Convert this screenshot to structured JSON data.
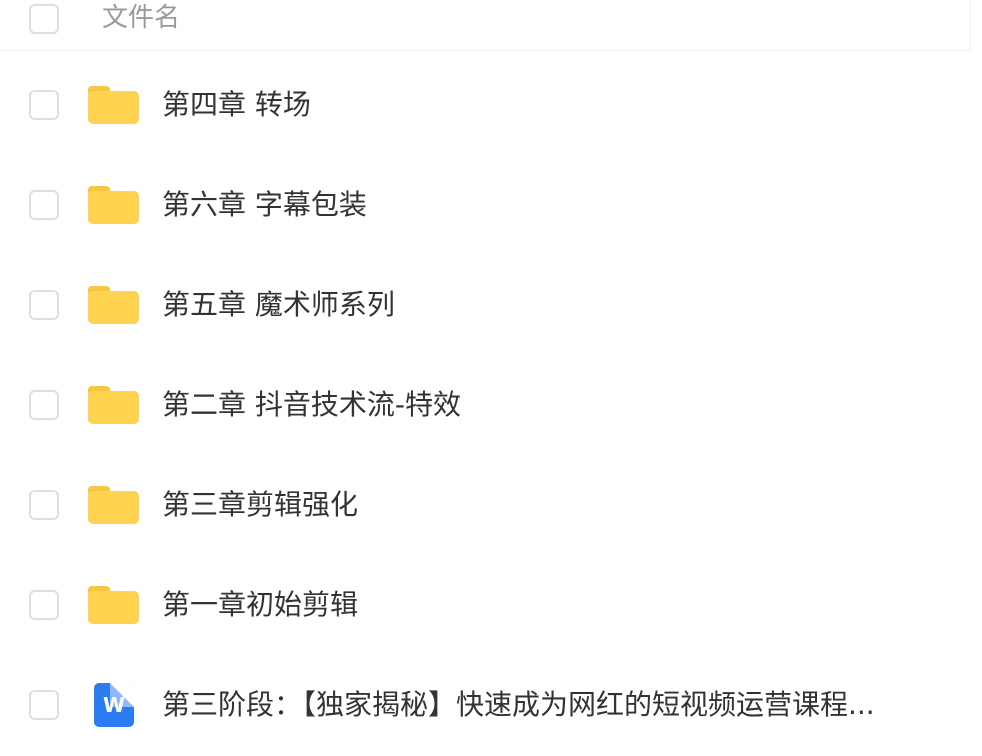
{
  "header": {
    "name_column_label": "文件名"
  },
  "files": [
    {
      "name": "第四章 转场",
      "type": "folder",
      "icon": "folder-icon"
    },
    {
      "name": "第六章 字幕包装",
      "type": "folder",
      "icon": "folder-icon"
    },
    {
      "name": "第五章 魔术师系列",
      "type": "folder",
      "icon": "folder-icon"
    },
    {
      "name": "第二章 抖音技术流-特效",
      "type": "folder",
      "icon": "folder-icon"
    },
    {
      "name": "第三章剪辑强化",
      "type": "folder",
      "icon": "folder-icon"
    },
    {
      "name": "第一章初始剪辑",
      "type": "folder",
      "icon": "folder-icon"
    },
    {
      "name": "第三阶段：【独家揭秘】快速成为网红的短视频运营课程...",
      "type": "document",
      "icon": "word-doc-icon",
      "icon_letter": "W"
    }
  ],
  "colors": {
    "folder": "#ffd24f",
    "word_doc": "#2b7cf0",
    "checkbox_border": "#dedede",
    "header_text": "#9a9a9a",
    "text": "#333333"
  }
}
